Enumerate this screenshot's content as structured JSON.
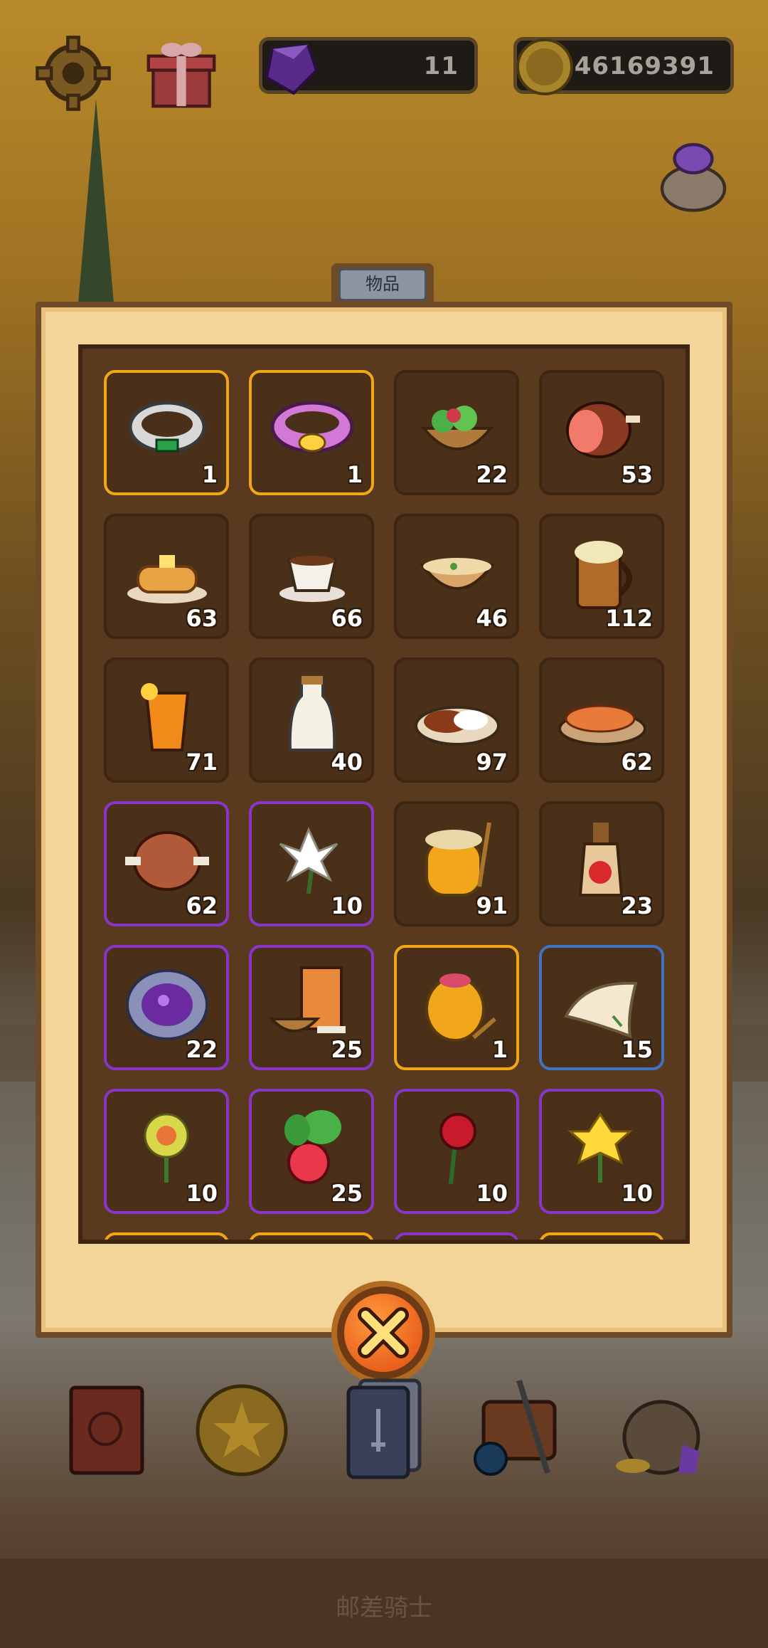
{
  "top_bar": {
    "gem_count": "11",
    "coin_count": "46169391"
  },
  "panel": {
    "tab_label": "物品"
  },
  "inventory": [
    {
      "icon": "emerald-ring-icon",
      "count": "1",
      "rarity": "gold"
    },
    {
      "icon": "pink-bracelet-icon",
      "count": "1",
      "rarity": "gold"
    },
    {
      "icon": "salad-bowl-icon",
      "count": "22",
      "rarity": "none"
    },
    {
      "icon": "ham-icon",
      "count": "53",
      "rarity": "none"
    },
    {
      "icon": "pancakes-icon",
      "count": "63",
      "rarity": "none"
    },
    {
      "icon": "coffee-cup-icon",
      "count": "66",
      "rarity": "none"
    },
    {
      "icon": "soup-bowl-icon",
      "count": "46",
      "rarity": "none"
    },
    {
      "icon": "ale-mug-icon",
      "count": "112",
      "rarity": "none"
    },
    {
      "icon": "orange-juice-icon",
      "count": "71",
      "rarity": "none"
    },
    {
      "icon": "milk-bottle-icon",
      "count": "40",
      "rarity": "none"
    },
    {
      "icon": "curry-rice-icon",
      "count": "97",
      "rarity": "none"
    },
    {
      "icon": "grilled-fish-icon",
      "count": "62",
      "rarity": "none"
    },
    {
      "icon": "roast-meat-icon",
      "count": "62",
      "rarity": "purple"
    },
    {
      "icon": "lily-flower-icon",
      "count": "10",
      "rarity": "purple"
    },
    {
      "icon": "honey-jar-icon",
      "count": "91",
      "rarity": "none"
    },
    {
      "icon": "apple-wine-icon",
      "count": "23",
      "rarity": "none"
    },
    {
      "icon": "amethyst-geode-icon",
      "count": "22",
      "rarity": "purple"
    },
    {
      "icon": "flour-sack-icon",
      "count": "25",
      "rarity": "purple"
    },
    {
      "icon": "golden-honey-pot-icon",
      "count": "1",
      "rarity": "gold"
    },
    {
      "icon": "parchment-icon",
      "count": "15",
      "rarity": "blue"
    },
    {
      "icon": "yellow-flower-icon",
      "count": "10",
      "rarity": "purple"
    },
    {
      "icon": "radish-icon",
      "count": "25",
      "rarity": "purple"
    },
    {
      "icon": "red-rose-icon",
      "count": "10",
      "rarity": "purple"
    },
    {
      "icon": "daffodil-icon",
      "count": "10",
      "rarity": "purple"
    }
  ],
  "bottom_nav": [
    {
      "icon": "journal-book-icon"
    },
    {
      "icon": "star-coin-icon"
    },
    {
      "icon": "card-deck-icon"
    },
    {
      "icon": "satchel-gear-icon"
    },
    {
      "icon": "treasure-bag-icon"
    }
  ],
  "footer": {
    "title": "邮差骑士"
  },
  "colors": {
    "gold_border": "#f2a614",
    "purple_border": "#8a34c8",
    "blue_border": "#3f74c4",
    "panel_bg": "#f3d59a"
  }
}
